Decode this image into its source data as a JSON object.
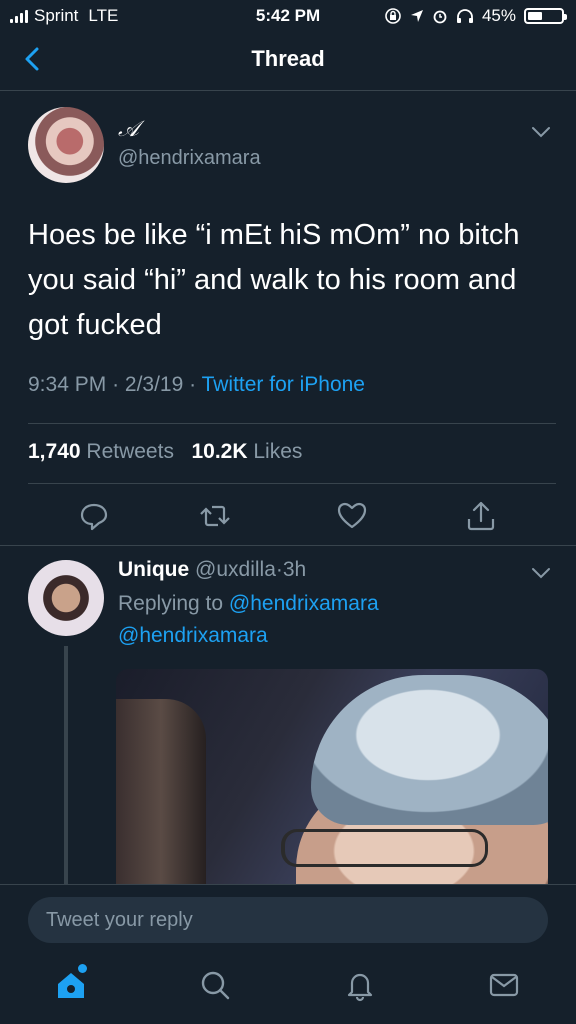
{
  "status_bar": {
    "carrier": "Sprint",
    "network": "LTE",
    "time": "5:42 PM",
    "battery_percent": "45%",
    "battery_level": 0.45
  },
  "navbar": {
    "title": "Thread",
    "back_icon": "chevron-left-icon"
  },
  "tweet": {
    "display_name": "𝒜",
    "handle": "@hendrixamara",
    "text": "Hoes be like “i mEt hiS mOm” no bitch you said “hi” and walk to his room and got fucked",
    "time": "9:34 PM",
    "date": "2/3/19",
    "source": "Twitter for iPhone",
    "retweets_count": "1,740",
    "retweets_label": "Retweets",
    "likes_count": "10.2K",
    "likes_label": "Likes",
    "actions": [
      "reply-icon",
      "retweet-icon",
      "like-icon",
      "share-icon"
    ]
  },
  "reply": {
    "display_name": "Unique",
    "handle": "@uxdilla",
    "age": "3h",
    "replying_to_label": "Replying to",
    "replying_to_handle": "@hendrixamara",
    "mention": "@hendrixamara"
  },
  "composer": {
    "placeholder": "Tweet your reply"
  },
  "tab_bar": {
    "tabs": [
      "home-icon",
      "search-icon",
      "notifications-icon",
      "messages-icon"
    ],
    "active": "home-icon",
    "accent": "#1da1f2"
  },
  "colors": {
    "background": "#15202b",
    "divider": "#38444d",
    "secondary_text": "#8899a6",
    "link": "#1da1f2"
  }
}
